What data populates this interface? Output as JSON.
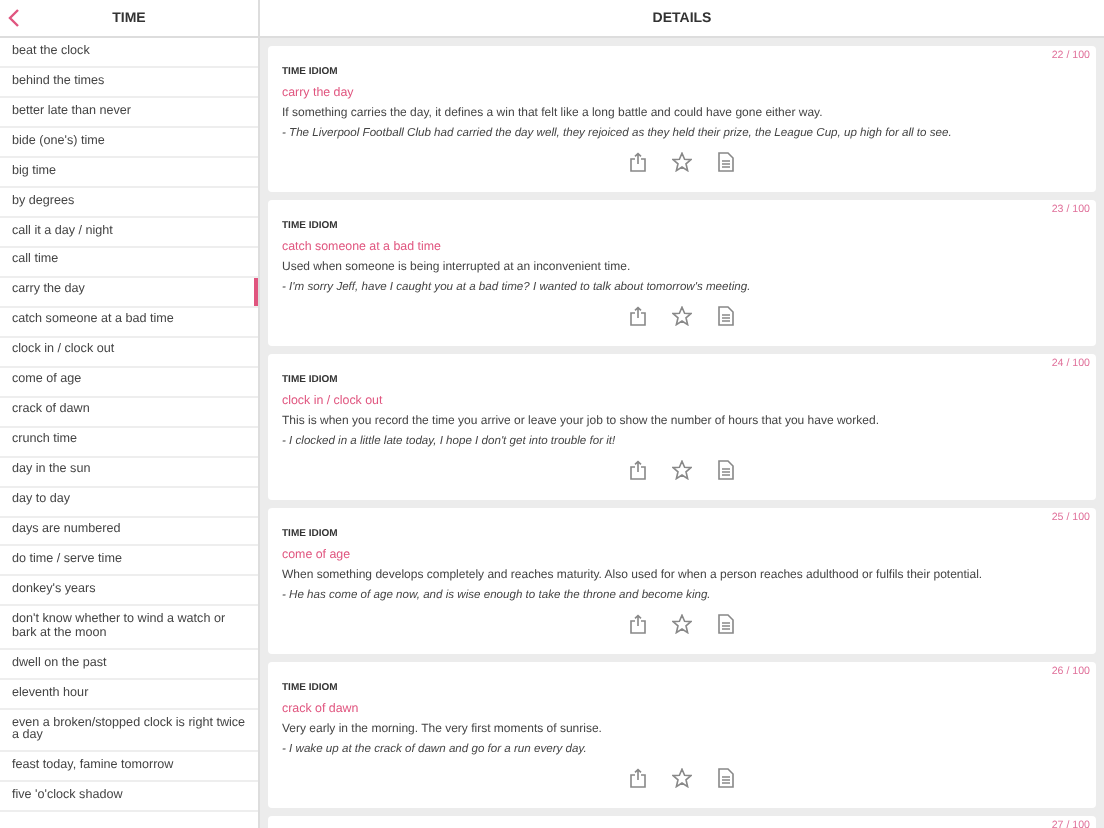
{
  "sidebar": {
    "title": "TIME",
    "items": [
      {
        "label": "beat the clock",
        "selected": false
      },
      {
        "label": "behind the times",
        "selected": false
      },
      {
        "label": "better late than never",
        "selected": false
      },
      {
        "label": "bide (one's) time",
        "selected": false
      },
      {
        "label": "big time",
        "selected": false
      },
      {
        "label": "by degrees",
        "selected": false
      },
      {
        "label": "call it a day / night",
        "selected": false
      },
      {
        "label": "call time",
        "selected": false
      },
      {
        "label": "carry the day",
        "selected": true
      },
      {
        "label": "catch someone at a bad time",
        "selected": false
      },
      {
        "label": "clock in / clock out",
        "selected": false
      },
      {
        "label": "come of age",
        "selected": false
      },
      {
        "label": "crack of dawn",
        "selected": false
      },
      {
        "label": "crunch time",
        "selected": false
      },
      {
        "label": "day in the sun",
        "selected": false
      },
      {
        "label": "day to day",
        "selected": false
      },
      {
        "label": "days are numbered",
        "selected": false
      },
      {
        "label": "do time / serve time",
        "selected": false
      },
      {
        "label": "donkey's years",
        "selected": false
      },
      {
        "label": "don't know whether to wind a watch or bark at the moon",
        "selected": false
      },
      {
        "label": "dwell on the past",
        "selected": false
      },
      {
        "label": "eleventh hour",
        "selected": false
      },
      {
        "label": "even a broken/stopped clock is right twice a day",
        "selected": false
      },
      {
        "label": "feast today, famine tomorrow",
        "selected": false
      },
      {
        "label": "five 'o'clock shadow",
        "selected": false
      }
    ]
  },
  "details": {
    "title": "DETAILS",
    "cards": [
      {
        "counter": "22 / 100",
        "category": "TIME IDIOM",
        "idiom": "carry the day",
        "meaning": "If something carries the day, it defines a win that felt like a long battle and could have gone either way.",
        "example": "- The Liverpool Football Club had carried the day well, they rejoiced as they held their prize, the League Cup, up high for all to see."
      },
      {
        "counter": "23 / 100",
        "category": "TIME IDIOM",
        "idiom": "catch someone at a bad time",
        "meaning": "Used when someone is being interrupted at an inconvenient time.",
        "example": "- I'm sorry Jeff, have I caught you at a bad time? I wanted to talk about tomorrow's meeting."
      },
      {
        "counter": "24 / 100",
        "category": "TIME IDIOM",
        "idiom": "clock in / clock out",
        "meaning": "This is when you record the time you arrive or leave your job to show the number of hours that you have worked.",
        "example": "- I clocked in a little late today, I hope I don't get into trouble for it!"
      },
      {
        "counter": "25 / 100",
        "category": "TIME IDIOM",
        "idiom": "come of age",
        "meaning": "When something develops completely and reaches maturity. Also used for when a person reaches adulthood or fulfils their potential.",
        "example": "- He has come of age now, and is wise enough to take the throne and become king."
      },
      {
        "counter": "26 / 100",
        "category": "TIME IDIOM",
        "idiom": "crack of dawn",
        "meaning": "Very early in the morning. The very first moments of sunrise.",
        "example": "- I wake up at the crack of dawn and go for a run every day."
      }
    ],
    "next_counter": "27 / 100"
  }
}
